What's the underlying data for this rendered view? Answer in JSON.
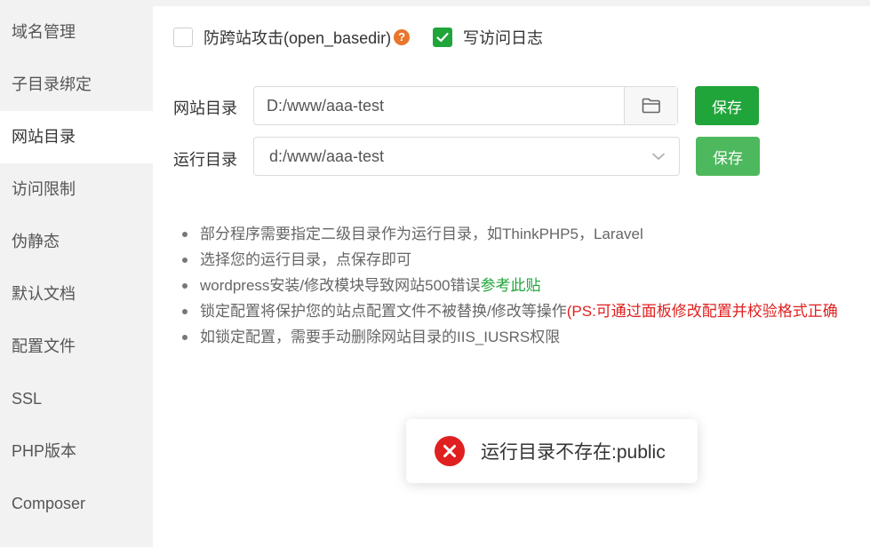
{
  "sidebar": {
    "items": [
      {
        "label": "域名管理"
      },
      {
        "label": "子目录绑定"
      },
      {
        "label": "网站目录"
      },
      {
        "label": "访问限制"
      },
      {
        "label": "伪静态"
      },
      {
        "label": "默认文档"
      },
      {
        "label": "配置文件"
      },
      {
        "label": "SSL"
      },
      {
        "label": "PHP版本"
      },
      {
        "label": "Composer"
      }
    ],
    "active_index": 2
  },
  "options": {
    "anti_xss": {
      "label": "防跨站攻击(open_basedir)",
      "checked": false,
      "help_icon": "question-icon"
    },
    "access_log": {
      "label": "写访问日志",
      "checked": true
    }
  },
  "site_dir": {
    "label": "网站目录",
    "value": "D:/www/aaa-test",
    "save_label": "保存"
  },
  "run_dir": {
    "label": "运行目录",
    "value": "d:/www/aaa-test",
    "save_label": "保存"
  },
  "tips": {
    "t1": "部分程序需要指定二级目录作为运行目录，如ThinkPHP5，Laravel",
    "t2": "选择您的运行目录，点保存即可",
    "t3_prefix": "wordpress安装/修改模块导致网站500错误",
    "t3_link": "参考此贴",
    "t4_prefix": "锁定配置将保护您的站点配置文件不被替换/修改等操作",
    "t4_red": "(PS:可通过面板修改配置并校验格式正确",
    "t5": "如锁定配置，需要手动删除网站目录的IIS_IUSRS权限"
  },
  "toast": {
    "message": "运行目录不存在:public",
    "icon": "error-icon"
  },
  "colors": {
    "accent": "#20a53a",
    "error": "#e02020",
    "help": "#e8762c"
  }
}
